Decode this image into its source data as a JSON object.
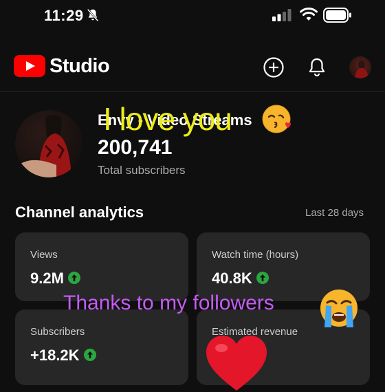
{
  "status_bar": {
    "time": "11:29",
    "icons": [
      "bell-muted-icon",
      "cellular-signal-icon",
      "wifi-icon",
      "battery-icon"
    ]
  },
  "app_bar": {
    "brand": "Studio",
    "logo_icon": "youtube-logo-icon",
    "actions": [
      "create-icon",
      "notifications-icon",
      "account-avatar"
    ],
    "brand_color": "#ff0000"
  },
  "channel": {
    "name": "Envy - Video Streams",
    "subscriber_count": "200,741",
    "subscriber_label": "Total subscribers"
  },
  "analytics": {
    "title": "Channel analytics",
    "period": "Last 28 days",
    "cards": [
      {
        "label": "Views",
        "value": "9.2M",
        "trend": "up"
      },
      {
        "label": "Watch time (hours)",
        "value": "40.8K",
        "trend": "up"
      },
      {
        "label": "Subscribers",
        "value": "+18.2K",
        "trend": "up"
      },
      {
        "label": "Estimated revenue",
        "value": "",
        "trend": ""
      }
    ],
    "trend_color": "#2ba640"
  },
  "stickers": {
    "love_text": "I love you",
    "love_emoji": "kissing-face-emoji",
    "thanks_text": "Thanks to my followers",
    "thanks_emoji": "crying-face-emoji",
    "heart_emoji": "red-heart-emoji",
    "love_color": "#ecec18",
    "thanks_color": "#c35bf5"
  }
}
